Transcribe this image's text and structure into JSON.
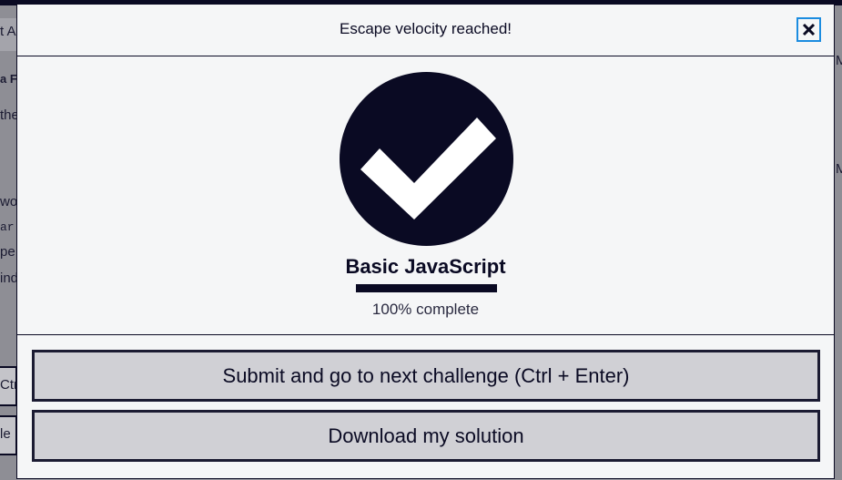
{
  "background": {
    "fragments": [
      "t Al",
      "a F",
      "the",
      "wo",
      "ar",
      "pe",
      "ind",
      "Ctr",
      "le",
      "M",
      "M"
    ]
  },
  "modal": {
    "title": "Escape velocity reached!",
    "close_icon": "close-icon",
    "check_icon": "checkmark-circle-icon",
    "course_title": "Basic JavaScript",
    "progress_fraction": 1.0,
    "progress_text": "100% complete",
    "buttons": {
      "submit_label": "Submit and go to next challenge (Ctrl + Enter)",
      "download_label": "Download my solution"
    }
  },
  "colors": {
    "primary": "#0a0a23",
    "focus_ring": "#1b8ce0",
    "button_bg": "#d0d0d5",
    "modal_bg": "#f5f6f7"
  }
}
